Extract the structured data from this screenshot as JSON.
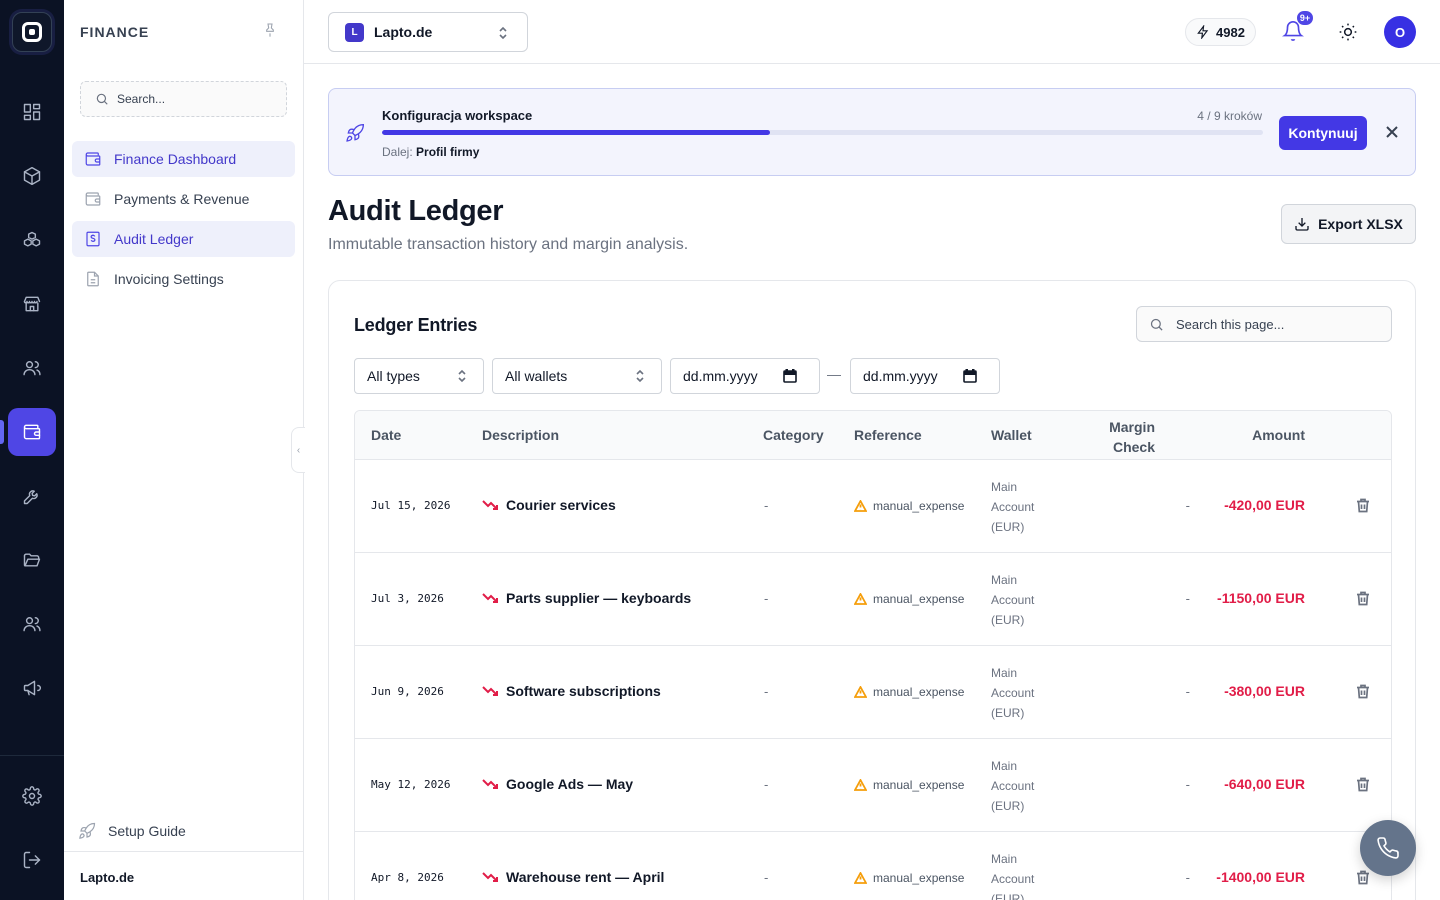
{
  "rail": {
    "logo": "app-logo",
    "items": [
      {
        "icon": "dashboard-grid-icon"
      },
      {
        "icon": "package-icon"
      },
      {
        "icon": "boxes-icon"
      },
      {
        "icon": "store-icon"
      },
      {
        "icon": "users-icon"
      },
      {
        "icon": "wallet-icon",
        "active": true
      },
      {
        "icon": "wrench-icon"
      },
      {
        "icon": "folder-open-icon"
      },
      {
        "icon": "team-icon"
      },
      {
        "icon": "megaphone-icon"
      },
      {
        "icon": "settings-icon"
      },
      {
        "icon": "logout-icon"
      }
    ]
  },
  "sidebar": {
    "heading": "FINANCE",
    "search_placeholder": "Search...",
    "items": [
      {
        "label": "Finance Dashboard",
        "icon": "wallet-icon",
        "active": true
      },
      {
        "label": "Payments & Revenue",
        "icon": "wallet-icon",
        "active": false
      },
      {
        "label": "Audit Ledger",
        "icon": "dollar-receipt-icon",
        "active": true
      },
      {
        "label": "Invoicing Settings",
        "icon": "document-icon",
        "active": false
      }
    ],
    "setup_guide": "Setup Guide",
    "footer_workspace": "Lapto.de"
  },
  "topbar": {
    "workspace_initial": "L",
    "workspace_name": "Lapto.de",
    "credits": "4982",
    "notifications_badge": "9+",
    "avatar_initial": "O"
  },
  "banner": {
    "title": "Konfiguracja workspace",
    "steps": "4 / 9 kroków",
    "progress_fraction": 0.44,
    "next_prefix": "Dalej:",
    "next_step": "Profil firmy",
    "continue_label": "Kontynuuj"
  },
  "page": {
    "title": "Audit Ledger",
    "subtitle": "Immutable transaction history and margin analysis.",
    "export_label": "Export XLSX"
  },
  "ledger": {
    "title": "Ledger Entries",
    "search_placeholder": "Search this page...",
    "filters": {
      "type": "All types",
      "wallet": "All wallets",
      "date_from": "dd.mm.yyyy",
      "date_separator": "—",
      "date_to": "dd.mm.yyyy"
    },
    "columns": {
      "date": "Date",
      "description": "Description",
      "category": "Category",
      "reference": "Reference",
      "wallet": "Wallet",
      "margin_line1": "Margin",
      "margin_line2": "Check",
      "amount": "Amount"
    },
    "rows": [
      {
        "date": "Jul 15, 2026",
        "description": "Courier services",
        "category": "-",
        "reference": "manual_expense",
        "wallet_l1": "Main",
        "wallet_l2": "Account",
        "wallet_l3": "(EUR)",
        "margin": "-",
        "amount": "-420,00 EUR"
      },
      {
        "date": "Jul 3, 2026",
        "description": "Parts supplier — keyboards",
        "category": "-",
        "reference": "manual_expense",
        "wallet_l1": "Main",
        "wallet_l2": "Account",
        "wallet_l3": "(EUR)",
        "margin": "-",
        "amount": "-1150,00 EUR"
      },
      {
        "date": "Jun 9, 2026",
        "description": "Software subscriptions",
        "category": "-",
        "reference": "manual_expense",
        "wallet_l1": "Main",
        "wallet_l2": "Account",
        "wallet_l3": "(EUR)",
        "margin": "-",
        "amount": "-380,00 EUR"
      },
      {
        "date": "May 12, 2026",
        "description": "Google Ads — May",
        "category": "-",
        "reference": "manual_expense",
        "wallet_l1": "Main",
        "wallet_l2": "Account",
        "wallet_l3": "(EUR)",
        "margin": "-",
        "amount": "-640,00 EUR"
      },
      {
        "date": "Apr 8, 2026",
        "description": "Warehouse rent — April",
        "category": "-",
        "reference": "manual_expense",
        "wallet_l1": "Main",
        "wallet_l2": "Account",
        "wallet_l3": "(EUR)",
        "margin": "-",
        "amount": "-1400,00 EUR"
      }
    ]
  },
  "colors": {
    "rail_bg": "#0b1224",
    "accent": "#4338e5",
    "negative_amount": "#e11d48",
    "warning": "#f59e0b"
  }
}
